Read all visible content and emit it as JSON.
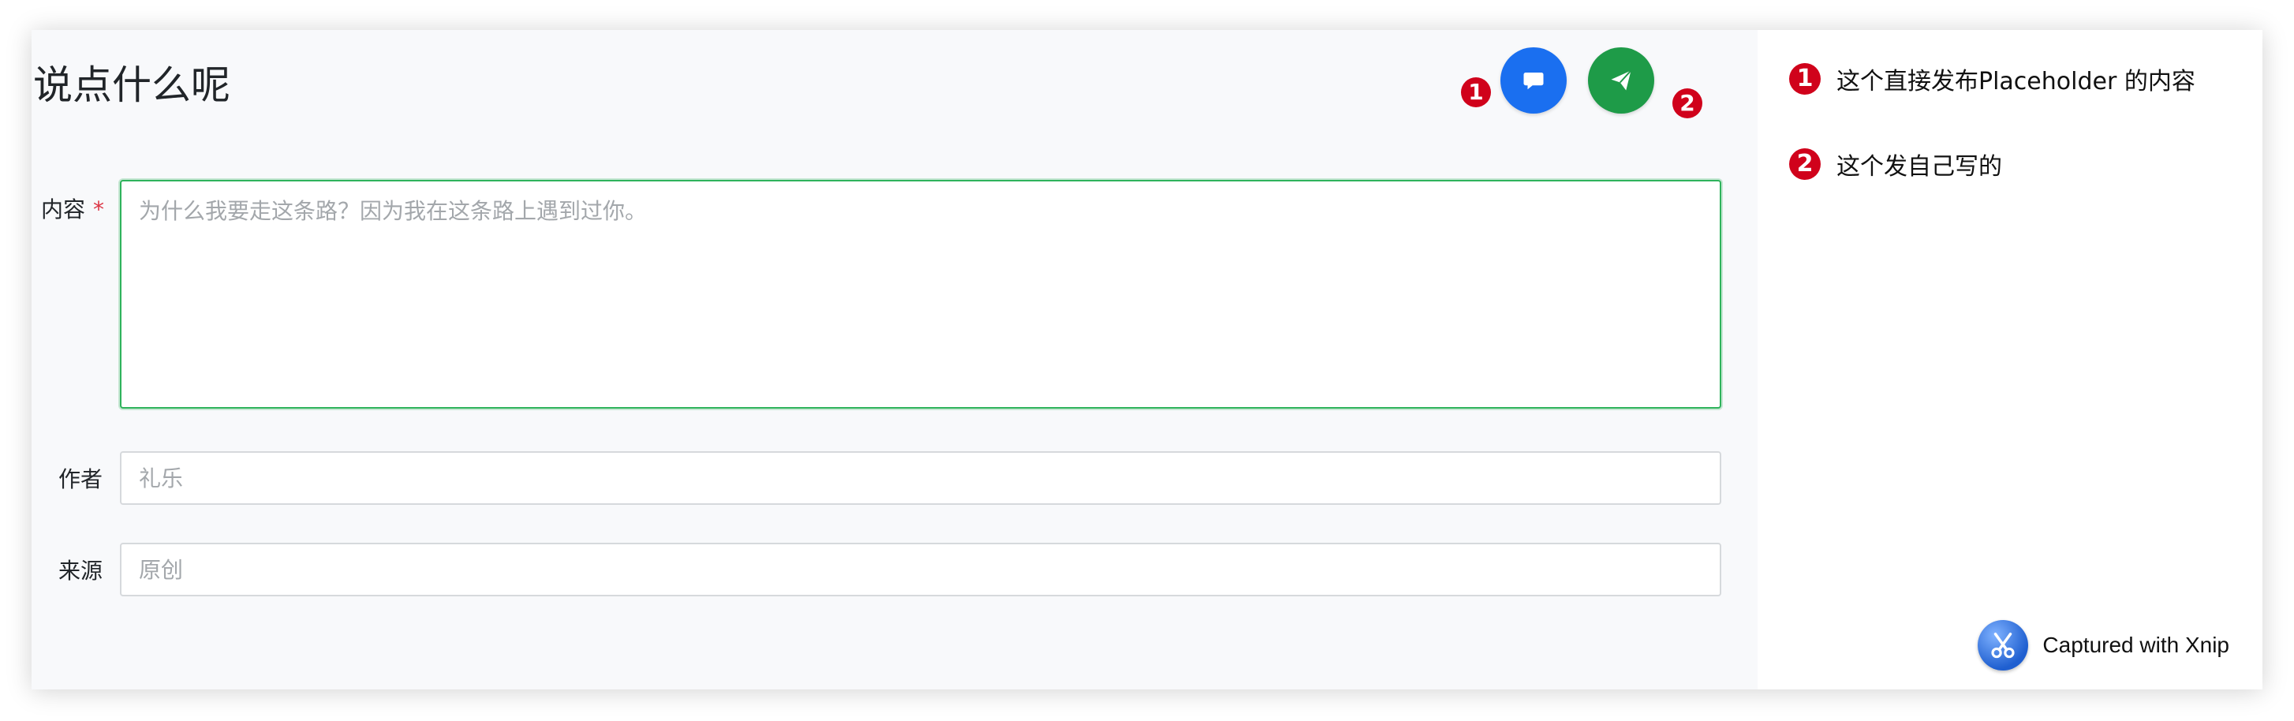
{
  "main": {
    "title": "说点什么呢",
    "content": {
      "label": "内容",
      "required_mark": "*",
      "placeholder": "为什么我要走这条路？因为我在这条路上遇到过你。"
    },
    "author": {
      "label": "作者",
      "placeholder": "礼乐"
    },
    "source": {
      "label": "来源",
      "placeholder": "原创"
    }
  },
  "fabs": {
    "comment": {
      "icon": "comment-icon",
      "color": "#1a6ff0",
      "badge": "1"
    },
    "send": {
      "icon": "send-icon",
      "color": "#1e9b48",
      "badge": "2"
    }
  },
  "notes": [
    {
      "num": "1",
      "text": "这个直接发布Placeholder 的内容"
    },
    {
      "num": "2",
      "text": "这个发自己写的"
    }
  ],
  "watermark": {
    "text": "Captured with Xnip",
    "icon": "scissors-icon"
  }
}
